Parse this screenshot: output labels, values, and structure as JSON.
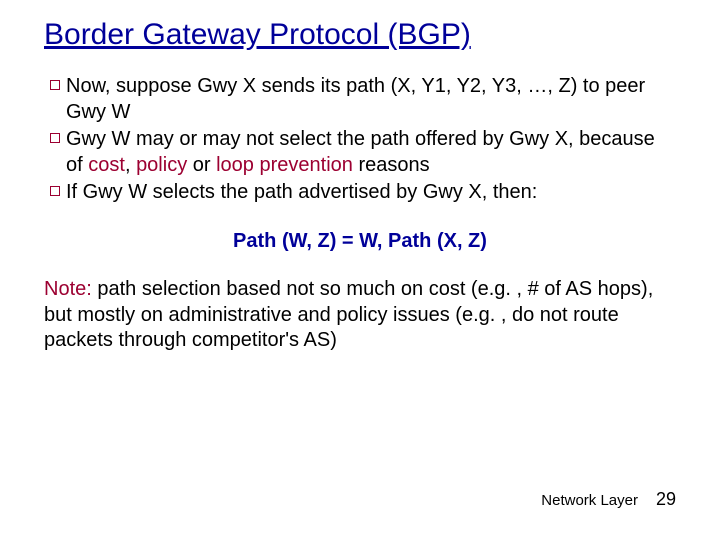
{
  "title": "Border Gateway Protocol (BGP)",
  "bullets": [
    {
      "pre": "Now,  suppose Gwy X sends its path (X, Y1, Y2, Y3, …, Z) to peer Gwy W"
    },
    {
      "pre": "Gwy W may or may not select the path offered by Gwy X, because of ",
      "hl1": "cost",
      "mid1": ", ",
      "hl2": "policy",
      "mid2": " or ",
      "hl3": "loop prevention",
      "post": " reasons"
    },
    {
      "pre": "If Gwy W selects the path advertised by Gwy X, then:"
    }
  ],
  "equation": "Path (W, Z)  =  W,  Path (X, Z)",
  "note": {
    "lead": "Note:",
    "body": " path selection based not so much on cost (e.g. , # of AS hops), but mostly on administrative and policy issues (e.g. , do not route packets through competitor's AS)"
  },
  "footer": {
    "label": "Network Layer",
    "page": "29"
  }
}
